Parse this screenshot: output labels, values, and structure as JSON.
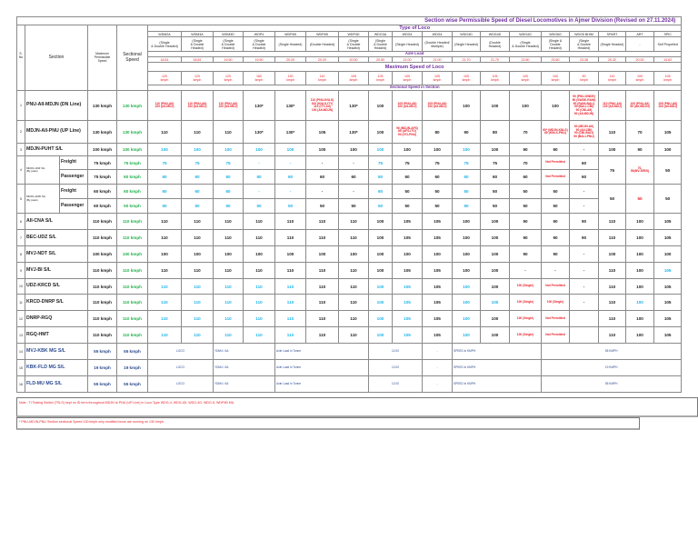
{
  "title": "Section wise Permissible Speed of Diesel Locomotives in Ajmer Division (Revised on 27.11.2024)",
  "header": {
    "sno": "S.\nNo\n.",
    "section": "Section",
    "max_speed": "Maximum\nPermissible\nSpeed",
    "sectional_speed": "Sectional\nSpeed",
    "type_of_loco": "Type of Loco",
    "axle_load": "Axle Load",
    "max_speed_loco": "Maximum Speed of Loco",
    "sectional_in_section": "Sectional Speed in Section",
    "locos": [
      {
        "name": "WDM2A",
        "desc": "(Single\n& Double Headed)",
        "axle": "18.81",
        "speed": "120\nkmph"
      },
      {
        "name": "WDM3A",
        "desc": "(Single\n& Double\nHeaded)",
        "axle": "18.81",
        "speed": "120\nkmph"
      },
      {
        "name": "WDM3D",
        "desc": "(Single\n& Double\nHeaded)",
        "axle": "19.50",
        "speed": "120\nkmph"
      },
      {
        "name": "WDP4",
        "desc": "(Single\n& Double\nHeaded)",
        "axle": "19.50",
        "speed": "160\nkmph"
      },
      {
        "name": "WDP4B",
        "desc": "(Single Headed)",
        "axle": "20.20",
        "speed": "130\nkmph"
      },
      {
        "name": "WDP4B",
        "desc": "(Double Headed)",
        "axle": "20.20",
        "speed": "110\nkmph"
      },
      {
        "name": "WDP4D",
        "desc": "(Single\n& Double\nHeaded)",
        "axle": "20.50",
        "speed": "105\nkmph"
      },
      {
        "name": "WDG3A",
        "desc": "(Single\n& Double\nHeaded)",
        "axle": "20.50",
        "speed": "105\nkmph"
      },
      {
        "name": "WDG4",
        "desc": "(Single Headed)",
        "axle": "21.00",
        "speed": "105\nkmph"
      },
      {
        "name": "WDG4",
        "desc": "(Double Headed/\nMultiple)",
        "axle": "21.00",
        "speed": "105\nkmph"
      },
      {
        "name": "WDG4D",
        "desc": "(Single Headed)",
        "axle": "21.70",
        "speed": "105\nkmph"
      },
      {
        "name": "WDG4D",
        "desc": "(Double\nHeaded)",
        "axle": "21.70",
        "speed": "105\nkmph"
      },
      {
        "name": "WDG4G",
        "desc": "(Single\n& Double Headed)",
        "axle": "22.80",
        "speed": "100\nkmph"
      },
      {
        "name": "WDG6G",
        "desc": "(Single &\nDouble\nHeaded)",
        "axle": "23.60",
        "speed": "100\nkmph"
      },
      {
        "name": "WDG5 BHIM",
        "desc": "(Single\n& Double\nHeaded)",
        "axle": "23.38",
        "speed": "90\nkmph"
      },
      {
        "name": "SPART",
        "desc": "(Single Headed)",
        "axle": "20.32",
        "speed": "110\nkmph"
      },
      {
        "name": "ART",
        "desc": "-",
        "axle": "20.00",
        "speed": "100\nkmph"
      },
      {
        "name": "SPIC",
        "desc": "Self Propelled",
        "axle": "14.62",
        "speed": "105\nkmph"
      }
    ]
  },
  "rows": [
    {
      "no": "1",
      "section": "PNU-AII-MDJN (DN Line)",
      "max": "130 kmph",
      "sect": "130 kmph",
      "cells": [
        {
          "t": "110 (PNU-AII)\n100 (AII-MDJ)",
          "c": "r"
        },
        {
          "t": "110 (PNU-AII)\n100 (AII-MDJ)",
          "c": "r"
        },
        {
          "t": "110 (PNU-AII)\n100 (AII-MDJ)",
          "c": "r"
        },
        "130*",
        "130*",
        {
          "t": "110 (PNU-KNLS)\n100 (KNLS-ITY)\n110 (ITY-AII)\n100 (AII-MDJN)",
          "c": "r"
        },
        "130*",
        "100",
        {
          "t": "105 (PNU-AII)\n100 (AII-MDJ)",
          "c": "r"
        },
        {
          "t": "105 (PNU-AII)\n100 (AII-MDJ)",
          "c": "r"
        },
        "100",
        "100",
        "100",
        "100",
        {
          "t": "90 (PNU-SWDE)\n90 (SWDE-RANI)\n90 (RANI-BALI)\n90 (BALI-CBI)\n90 (CBI-AII)\n90 (AII-MDJN)",
          "c": "r"
        },
        {
          "t": "110 (PNU-AII)\n100 (AII-MDJ)",
          "c": "r"
        },
        {
          "t": "100 (PNU-AII)\n90 (AII-MDJN)",
          "c": "r"
        },
        {
          "t": "105 (PNU-AII)\n100 (AII-MDJ)",
          "c": "r"
        }
      ]
    },
    {
      "no": "2",
      "section": "MDJN-AII-PNU (UP Line)",
      "max": "130 kmph",
      "sect": "130 kmph",
      "cells": [
        "110",
        "110",
        "110",
        "130*",
        "130*",
        "105",
        "130*",
        "100",
        {
          "t": "90 (MDJN-AFS)\n85 (AFS-ITO)\n90 (ITO-PNU)",
          "c": "r"
        },
        "80",
        "90",
        "80",
        "70",
        {
          "t": "60* (MDJN-KNLS)\n80 (KNLS-PNU)",
          "c": "r"
        },
        {
          "t": "90 (MDJN-AII)\n90 (AII-CBI)\n90 (CBI-BALI)\n90 (BALI-PNU)",
          "c": "r"
        },
        "110",
        "70",
        "105"
      ]
    },
    {
      "no": "3",
      "section": "MDJN-PUHT S/L",
      "max": "100 kmph",
      "sect": "100 kmph",
      "cells": [
        {
          "t": "100",
          "c": "b"
        },
        {
          "t": "100",
          "c": "b"
        },
        {
          "t": "100",
          "c": "b"
        },
        {
          "t": "100",
          "c": "b"
        },
        {
          "t": "100",
          "c": "b"
        },
        "100",
        "100",
        {
          "t": "100",
          "c": "b"
        },
        "100",
        "100",
        {
          "t": "100",
          "c": "b"
        },
        "100",
        "90",
        "90",
        "-",
        "100",
        "90",
        "100"
      ]
    },
    {
      "no": "4",
      "section": "MDJN-UDZ S/L\n(By pass)",
      "sub": "Freight",
      "max": "75 kmph",
      "sect": "75 kmph",
      "grouped": true,
      "cells": [
        {
          "t": "75",
          "c": "b"
        },
        {
          "t": "75",
          "c": "b"
        },
        {
          "t": "75",
          "c": "b"
        },
        {
          "t": "-",
          "c": "b"
        },
        {
          "t": "-",
          "c": "b"
        },
        "-",
        "-",
        {
          "t": "75",
          "c": "b"
        },
        "75",
        "75",
        {
          "t": "75",
          "c": "b"
        },
        "75",
        "70",
        {
          "t": "Not Permitted",
          "c": "r"
        },
        "60",
        {
          "t": "75",
          "rs": 2
        },
        {
          "t": "70,\n50(MV-SIR/S)",
          "c": "r",
          "rs": 2
        },
        {
          "t": "50",
          "rs": 2
        }
      ]
    },
    {
      "sub": "Passenger",
      "max": "75 kmph",
      "sect": "60 kmph",
      "cont": true,
      "cells": [
        {
          "t": "60",
          "c": "b"
        },
        {
          "t": "60",
          "c": "b"
        },
        {
          "t": "60",
          "c": "b"
        },
        {
          "t": "60",
          "c": "b"
        },
        {
          "t": "60",
          "c": "b"
        },
        "60",
        "60",
        {
          "t": "60",
          "c": "b"
        },
        "60",
        "60",
        {
          "t": "60",
          "c": "b"
        },
        "60",
        "60",
        {
          "t": "Not Permitted",
          "c": "r"
        },
        "60"
      ]
    },
    {
      "no": "5",
      "section": "MDJN-AMD S/L\n(By pass)",
      "sub": "Freight",
      "max": "60 kmph",
      "sect": "60 kmph",
      "grouped": true,
      "cells": [
        {
          "t": "60",
          "c": "b"
        },
        {
          "t": "60",
          "c": "b"
        },
        {
          "t": "60",
          "c": "b"
        },
        {
          "t": "-",
          "c": "b"
        },
        {
          "t": "-",
          "c": "b"
        },
        "-",
        "-",
        {
          "t": "60",
          "c": "b"
        },
        "50",
        "50",
        {
          "t": "50",
          "c": "b"
        },
        "50",
        "50",
        "50",
        "-",
        {
          "t": "50",
          "rs": 2
        },
        {
          "t": "50",
          "c": "r",
          "rs": 2
        },
        {
          "t": "50",
          "rs": 2
        }
      ]
    },
    {
      "sub": "Passenger",
      "max": "60 kmph",
      "sect": "50 kmph",
      "cont": true,
      "cells": [
        {
          "t": "50",
          "c": "b"
        },
        {
          "t": "50",
          "c": "b"
        },
        {
          "t": "50",
          "c": "b"
        },
        {
          "t": "50",
          "c": "b"
        },
        {
          "t": "50",
          "c": "b"
        },
        "50",
        "50",
        {
          "t": "50",
          "c": "b"
        },
        "50",
        "50",
        {
          "t": "50",
          "c": "b"
        },
        "50",
        "50",
        "50",
        "-"
      ]
    },
    {
      "no": "6",
      "section": "AII-CNA S/L",
      "max": "110 kmph",
      "sect": "110 kmph",
      "cells": [
        "110",
        "110",
        "110",
        "110",
        "110",
        "110",
        "110",
        "100",
        "105",
        "105",
        "100",
        "100",
        "90",
        "90",
        "90",
        "110",
        "100",
        "105"
      ]
    },
    {
      "no": "7",
      "section": "BEC-UDZ S/L",
      "max": "110 kmph",
      "sect": "110 kmph",
      "cells": [
        "110",
        "110",
        "110",
        "110",
        "110",
        "110",
        "110",
        "100",
        "105",
        "105",
        "100",
        "100",
        "90",
        "90",
        "90",
        "110",
        "100",
        "105"
      ]
    },
    {
      "no": "8",
      "section": "MVJ-NDT S/L",
      "max": "100 kmph",
      "sect": "100 kmph",
      "cells": [
        "100",
        "100",
        "100",
        "100",
        "100",
        "100",
        "100",
        "100",
        "100",
        "100",
        "100",
        "100",
        "90",
        "90",
        "-",
        "100",
        "100",
        "100"
      ]
    },
    {
      "no": "9",
      "section": "MVJ-BI S/L",
      "max": "110 kmph",
      "sect": "110 kmph",
      "cells": [
        "110",
        "110",
        "110",
        "110",
        "110",
        "110",
        "110",
        "100",
        "105",
        "105",
        "100",
        "100",
        "-",
        "-",
        "-",
        "110",
        "100",
        {
          "t": "105",
          "c": "b"
        }
      ]
    },
    {
      "no": "10",
      "section": "UDZ-KRCD S/L",
      "max": "110 kmph",
      "sect": "110 kmph",
      "cells": [
        {
          "t": "110",
          "c": "b"
        },
        {
          "t": "110",
          "c": "b"
        },
        {
          "t": "110",
          "c": "b"
        },
        {
          "t": "110",
          "c": "b"
        },
        {
          "t": "110",
          "c": "b"
        },
        "110",
        "110",
        {
          "t": "100",
          "c": "b"
        },
        {
          "t": "105",
          "c": "b"
        },
        "105",
        {
          "t": "100",
          "c": "b"
        },
        "100",
        {
          "t": "100 (Single)",
          "c": "r"
        },
        {
          "t": "Not Permitted",
          "c": "r"
        },
        "-",
        "110",
        "100",
        "105"
      ]
    },
    {
      "no": "11",
      "section": "KRCD-DNRP S/L",
      "max": "110 kmph",
      "sect": "110 kmph",
      "cells": [
        {
          "t": "110",
          "c": "b"
        },
        {
          "t": "110",
          "c": "b"
        },
        {
          "t": "110",
          "c": "b"
        },
        {
          "t": "110",
          "c": "b"
        },
        {
          "t": "110",
          "c": "b"
        },
        "110",
        "110",
        {
          "t": "100",
          "c": "b"
        },
        {
          "t": "105",
          "c": "b"
        },
        "105",
        {
          "t": "100",
          "c": "b"
        },
        {
          "t": "100",
          "c": "b"
        },
        {
          "t": "100 (Single)",
          "c": "r"
        },
        {
          "t": "100 (Single)",
          "c": "r"
        },
        "-",
        "110",
        {
          "t": "100",
          "c": "b"
        },
        "105"
      ]
    },
    {
      "no": "12",
      "section": "DNRP-RGQ",
      "max": "110 kmph",
      "sect": "110 kmph",
      "cells": [
        {
          "t": "110",
          "c": "b"
        },
        {
          "t": "110",
          "c": "b"
        },
        {
          "t": "110",
          "c": "b"
        },
        {
          "t": "110",
          "c": "b"
        },
        {
          "t": "110",
          "c": "b"
        },
        "110",
        "110",
        {
          "t": "100",
          "c": "b"
        },
        {
          "t": "105",
          "c": "b"
        },
        "105",
        {
          "t": "100",
          "c": "b"
        },
        "100",
        {
          "t": "100 (Single)",
          "c": "r"
        },
        {
          "t": "Not Permitted",
          "c": "r"
        },
        "",
        "110",
        "100",
        "105"
      ]
    },
    {
      "no": "13",
      "section": "RGQ-HMT",
      "max": "110 kmph",
      "sect": "110 kmph",
      "cells": [
        {
          "t": "110",
          "c": "b"
        },
        {
          "t": "110",
          "c": "b"
        },
        {
          "t": "110",
          "c": "b"
        },
        {
          "t": "110",
          "c": "b"
        },
        {
          "t": "110",
          "c": "b"
        },
        "110",
        "110",
        {
          "t": "100",
          "c": "b"
        },
        {
          "t": "105",
          "c": "b"
        },
        "105",
        {
          "t": "100",
          "c": "b"
        },
        "100",
        {
          "t": "100 (Single)",
          "c": "r"
        },
        {
          "t": "Not Permitted",
          "c": "r"
        },
        "",
        "110",
        "100",
        "105"
      ]
    },
    {
      "no": "14",
      "section": "MVJ-KBK MG S/L",
      "max": "55 kmph",
      "sect": "55 kmph",
      "mg": true,
      "cells": [
        {
          "t": "LOCO",
          "cs": 2
        },
        {
          "t": "YDM4 / 4A",
          "cs": 2,
          "al": "l"
        },
        {
          "t": "Axle Load in Tonne",
          "cs": 3,
          "al": "l"
        },
        {
          "t": "12.00",
          "cs": 2
        },
        {
          "t": "-"
        },
        {
          "t": "SPEED in KMPH",
          "cs": 3,
          "al": "l"
        },
        {
          "t": "55 KMPH",
          "cs": 5
        }
      ]
    },
    {
      "no": "15",
      "section": "KBK-FLD MG S/L",
      "max": "19 kmph",
      "sect": "19 kmph",
      "mg": true,
      "cells": [
        {
          "t": "LOCO",
          "cs": 2
        },
        {
          "t": "YDM4 / 4A",
          "cs": 2,
          "al": "l"
        },
        {
          "t": "Axle Load in Tonne",
          "cs": 3,
          "al": "l"
        },
        {
          "t": "12.00",
          "cs": 2
        },
        {
          "t": "-"
        },
        {
          "t": "SPEED in KMPH",
          "cs": 3,
          "al": "l"
        },
        {
          "t": "19 KMPH",
          "cs": 5
        }
      ]
    },
    {
      "no": "16",
      "section": "FLD-MU MG S/L",
      "max": "55 kmph",
      "sect": "55 kmph",
      "mg": true,
      "cells": [
        {
          "t": "LOCO",
          "cs": 2
        },
        {
          "t": "YDM4 / 4A",
          "cs": 2,
          "al": "l"
        },
        {
          "t": "Axle Load in Tonne",
          "cs": 3,
          "al": "l"
        },
        {
          "t": "12.00",
          "cs": 2
        },
        {
          "t": "-"
        },
        {
          "t": "SPEED in KMPH",
          "cs": 3,
          "al": "l"
        },
        {
          "t": "55 KMPH",
          "cs": 5
        }
      ]
    }
  ],
  "notes": [
    "Note : TI Testing Switch (TSLS) kept on ID term throughout MDJN to PNU (UP Line) in Loco Type WDG-4, WDG-4D, WDG-4G, WDG-5, WDP4B MU.",
    "* PNU-MDJN-PNU Section sectional Speed 130 kmph only modified locos are running on 130 kmph."
  ],
  "colors": {
    "red": "#e8202a",
    "blue": "#1fb3ea",
    "green": "#22b14c",
    "purple": "#7030a0",
    "mg_blue": "#2b4a8f"
  }
}
